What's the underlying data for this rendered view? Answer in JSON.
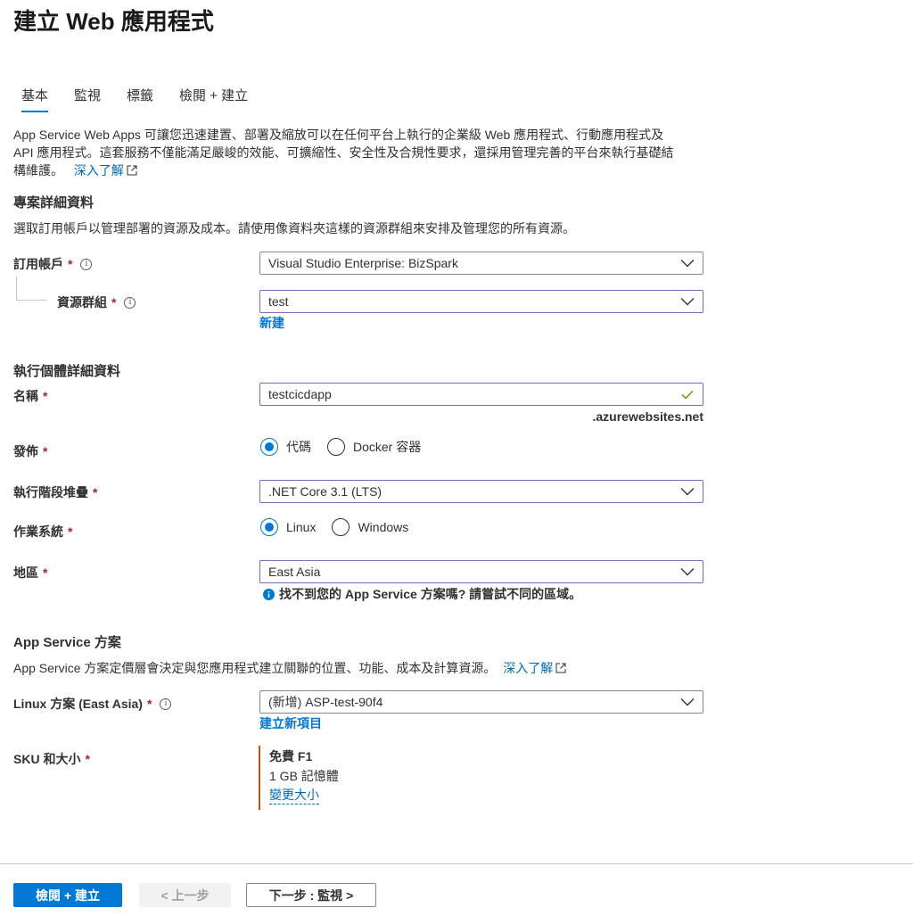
{
  "page": {
    "title": "建立 Web 應用程式"
  },
  "tabs": [
    {
      "label": "基本",
      "active": true
    },
    {
      "label": "監視",
      "active": false
    },
    {
      "label": "標籤",
      "active": false
    },
    {
      "label": "檢閱 + 建立",
      "active": false
    }
  ],
  "intro": {
    "line1": "App Service Web Apps 可讓您迅速建置、部署及縮放可以在任何平台上執行的企業級 Web 應用程式、行動應用程式及",
    "line2": "API 應用程式。這套服務不僅能滿足嚴峻的效能、可擴縮性、安全性及合規性要求，還採用管理完善的平台來執行基礎結",
    "line3": "構維護。",
    "learn_more": "深入了解"
  },
  "project": {
    "heading": "專案詳細資料",
    "description": "選取訂用帳戶以管理部署的資源及成本。請使用像資料夾這樣的資源群組來安排及管理您的所有資源。",
    "subscription_label": "訂用帳戶",
    "subscription_value": "Visual Studio Enterprise: BizSpark",
    "resource_group_label": "資源群組",
    "resource_group_value": "test",
    "create_new": "新建"
  },
  "instance": {
    "heading": "執行個體詳細資料",
    "name_label": "名稱",
    "name_value": "testcicdapp",
    "name_suffix": ".azurewebsites.net",
    "publish_label": "發佈",
    "publish_options": [
      "代碼",
      "Docker 容器"
    ],
    "publish_selected": "代碼",
    "runtime_label": "執行階段堆疊",
    "runtime_value": ".NET Core 3.1 (LTS)",
    "os_label": "作業系統",
    "os_options": [
      "Linux",
      "Windows"
    ],
    "os_selected": "Linux",
    "region_label": "地區",
    "region_value": "East Asia",
    "region_hint": "找不到您的 App Service 方案嗎? 請嘗試不同的區域。"
  },
  "plan": {
    "heading": "App Service 方案",
    "description": "App Service 方案定價層會決定與您應用程式建立關聯的位置、功能、成本及計算資源。",
    "learn_more": "深入了解",
    "linux_plan_label": "Linux 方案 (East Asia)",
    "linux_plan_value": "(新增) ASP-test-90f4",
    "create_new": "建立新項目",
    "sku_label": "SKU 和大小",
    "sku_tier": "免費 F1",
    "sku_memory": "1 GB 記憶體",
    "sku_change": "變更大小"
  },
  "required_mark": "*",
  "footer": {
    "review_create": "檢閱 + 建立",
    "previous": "< 上一步",
    "next": "下一步 : 監視 >"
  },
  "colors": {
    "accent": "#0078d4",
    "required": "#a4262c",
    "focus_border": "#8764b8",
    "valid_check": "#57a300",
    "sku_bar": "#ca5010"
  }
}
